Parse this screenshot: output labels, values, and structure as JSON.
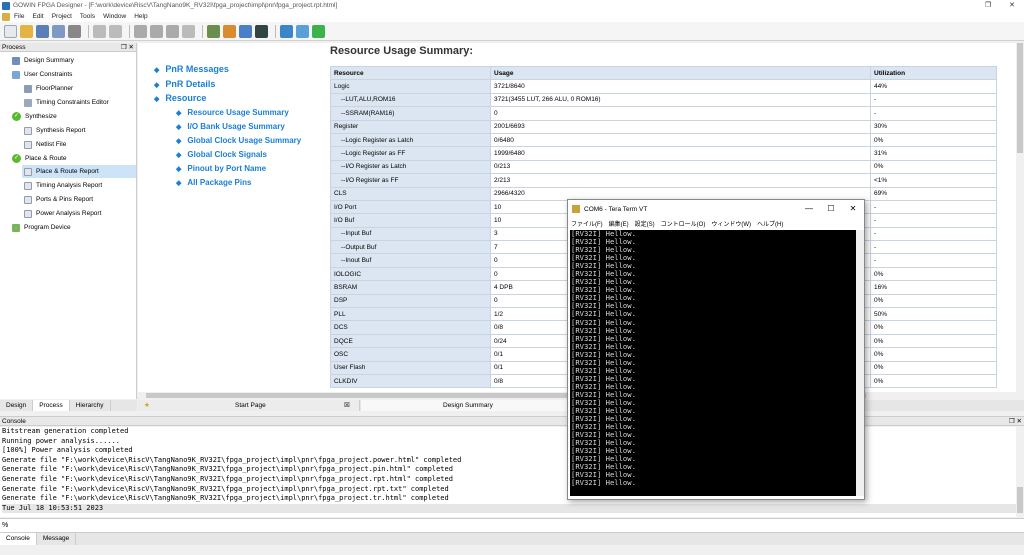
{
  "window": {
    "title": "GOWIN FPGA Designer - [F:\\work\\device\\RiscV\\TangNano9K_RV32I\\fpga_project\\impl\\pnr\\fpga_project.rpt.html]"
  },
  "menu": [
    "File",
    "Edit",
    "Project",
    "Tools",
    "Window",
    "Help"
  ],
  "process_panel": {
    "title": "Process",
    "items": [
      {
        "label": "Design Summary"
      },
      {
        "label": "User Constraints"
      },
      {
        "label": "FloorPlanner"
      },
      {
        "label": "Timing Constraints Editor"
      },
      {
        "label": "Synthesize"
      },
      {
        "label": "Synthesis Report"
      },
      {
        "label": "Netlist File"
      },
      {
        "label": "Place & Route"
      },
      {
        "label": "Place & Route Report"
      },
      {
        "label": "Timing Analysis Report"
      },
      {
        "label": "Ports & Pins Report"
      },
      {
        "label": "Power Analysis Report"
      },
      {
        "label": "Program Device"
      }
    ]
  },
  "left_tabs": [
    "Design",
    "Process",
    "Hierarchy"
  ],
  "report": {
    "heading": "Resource Usage Summary:",
    "nav": [
      {
        "label": "PnR Messages"
      },
      {
        "label": "PnR Details"
      },
      {
        "label": "Resource"
      },
      {
        "label": "Resource Usage Summary"
      },
      {
        "label": "I/O Bank Usage Summary"
      },
      {
        "label": "Global Clock Usage Summary"
      },
      {
        "label": "Global Clock Signals"
      },
      {
        "label": "Pinout by Port Name"
      },
      {
        "label": "All Package Pins"
      }
    ],
    "table_headers": [
      "Resource",
      "Usage",
      "Utilization"
    ],
    "rows": [
      [
        "Logic",
        "3721/8640",
        "44%"
      ],
      [
        "--LUT,ALU,ROM16",
        "3721(3455 LUT, 266 ALU, 0 ROM16)",
        "-"
      ],
      [
        "--SSRAM(RAM16)",
        "0",
        "-"
      ],
      [
        "Register",
        "2001/6693",
        "30%"
      ],
      [
        "--Logic Register as Latch",
        "0/6480",
        "0%"
      ],
      [
        "--Logic Register as FF",
        "1999/6480",
        "31%"
      ],
      [
        "--I/O Register as Latch",
        "0/213",
        "0%"
      ],
      [
        "--I/O Register as FF",
        "2/213",
        "<1%"
      ],
      [
        "CLS",
        "2966/4320",
        "69%"
      ],
      [
        "I/O Port",
        "10",
        "-"
      ],
      [
        "I/O Buf",
        "10",
        "-"
      ],
      [
        "--Input Buf",
        "3",
        "-"
      ],
      [
        "--Output Buf",
        "7",
        "-"
      ],
      [
        "--Inout Buf",
        "0",
        "-"
      ],
      [
        "IOLOGIC",
        "0",
        "0%"
      ],
      [
        "BSRAM",
        "4 DPB",
        "16%"
      ],
      [
        "DSP",
        "0",
        "0%"
      ],
      [
        "PLL",
        "1/2",
        "50%"
      ],
      [
        "DCS",
        "0/8",
        "0%"
      ],
      [
        "DQCE",
        "0/24",
        "0%"
      ],
      [
        "OSC",
        "0/1",
        "0%"
      ],
      [
        "User Flash",
        "0/1",
        "0%"
      ],
      [
        "CLKDIV",
        "0/8",
        "0%"
      ]
    ]
  },
  "doc_tabs": [
    {
      "label": "Start Page"
    },
    {
      "label": "Design Summary"
    }
  ],
  "console": {
    "title": "Console",
    "lines": [
      "Bitstream generation completed",
      "Running power analysis......",
      "[100%] Power analysis completed",
      "Generate file \"F:\\work\\device\\RiscV\\TangNano9K_RV32I\\fpga_project\\impl\\pnr\\fpga_project.power.html\" completed",
      "Generate file \"F:\\work\\device\\RiscV\\TangNano9K_RV32I\\fpga_project\\impl\\pnr\\fpga_project.pin.html\" completed",
      "Generate file \"F:\\work\\device\\RiscV\\TangNano9K_RV32I\\fpga_project\\impl\\pnr\\fpga_project.rpt.html\" completed",
      "Generate file \"F:\\work\\device\\RiscV\\TangNano9K_RV32I\\fpga_project\\impl\\pnr\\fpga_project.rpt.txt\" completed",
      "Generate file \"F:\\work\\device\\RiscV\\TangNano9K_RV32I\\fpga_project\\impl\\pnr\\fpga_project.tr.html\" completed",
      "Tue Jul 18 10:53:51 2023"
    ],
    "prompt": "%"
  },
  "bottom_tabs": [
    "Console",
    "Message"
  ],
  "teraterm": {
    "title": "COM6 - Tera Term VT",
    "menu": [
      "ファイル(F)",
      "編集(E)",
      "設定(S)",
      "コントロール(O)",
      "ウィンドウ(W)",
      "ヘルプ(H)"
    ],
    "line_text": "[RV32I] Hellow.",
    "line_count": 32
  },
  "colors": {
    "link": "#1a7fd4",
    "table_header": "#dbe6f2",
    "selection": "#cde3f7",
    "check_green": "#5bb830"
  }
}
